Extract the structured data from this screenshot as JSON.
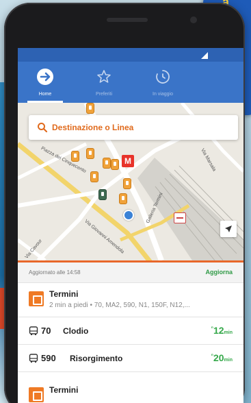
{
  "promo": {
    "line1": "a",
    "line2": "6",
    "line3": "n"
  },
  "tabs": [
    {
      "label": "Home",
      "icon": "arrow-circle-icon",
      "active": true
    },
    {
      "label": "Preferiti",
      "icon": "star-icon",
      "active": false
    },
    {
      "label": "In viaggio",
      "icon": "timer-icon",
      "active": false
    }
  ],
  "search": {
    "placeholder": "Destinazione o Linea"
  },
  "map": {
    "streets": [
      "Piazza dei Cinquecento",
      "Via Giovanni Amendola",
      "Via Marsala",
      "Galleria Termini",
      "Via Cavour"
    ],
    "metro_label": "M"
  },
  "status": {
    "updated": "Aggiornato alle 14:58",
    "refresh": "Aggiorna"
  },
  "stops": [
    {
      "name": "Termini",
      "detail": "2 min a piedi • 70, MA2, 590, N1, 150F, N12,...",
      "lines": [
        {
          "number": "70",
          "destination": "Clodio",
          "eta": "12",
          "unit": "min"
        },
        {
          "number": "590",
          "destination": "Risorgimento",
          "eta": "20",
          "unit": "min"
        }
      ]
    },
    {
      "name": "Termini"
    }
  ],
  "colors": {
    "primary": "#3a74c8",
    "accent": "#e8672a",
    "eta": "#35a84a"
  }
}
